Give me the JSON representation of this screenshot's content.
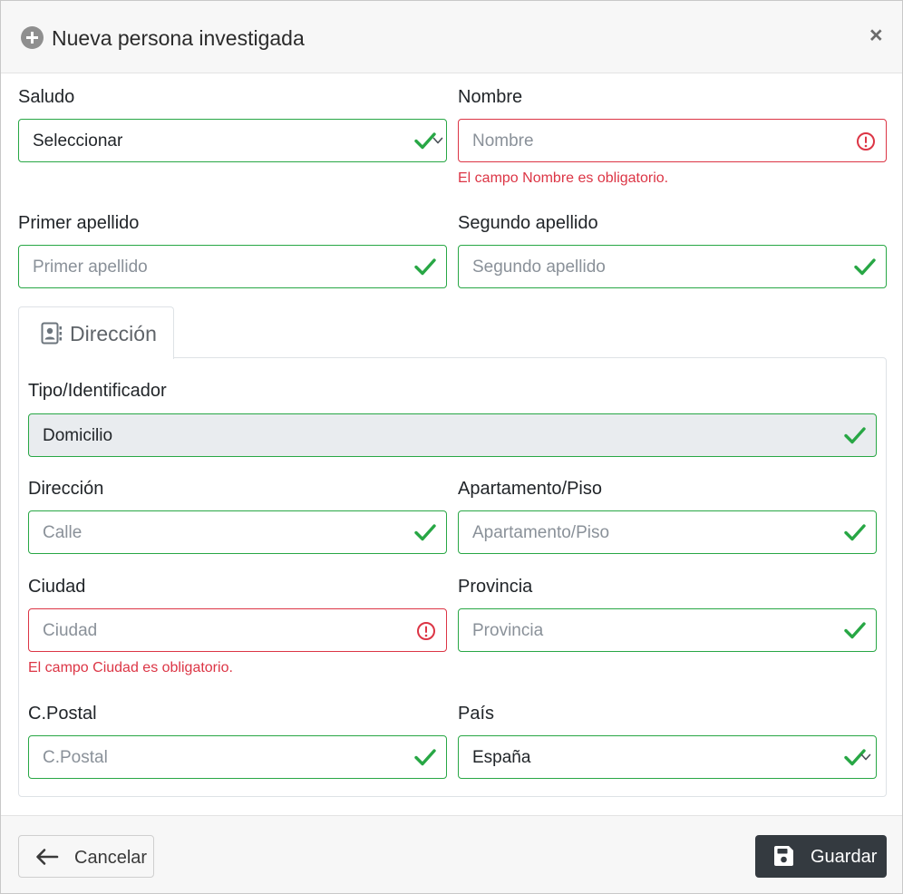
{
  "header": {
    "title": "Nueva persona investigada",
    "close": "×"
  },
  "form": {
    "saludo": {
      "label": "Saludo",
      "value": "Seleccionar"
    },
    "nombre": {
      "label": "Nombre",
      "placeholder": "Nombre",
      "error": "El campo Nombre es obligatorio."
    },
    "primer_apellido": {
      "label": "Primer apellido",
      "placeholder": "Primer apellido"
    },
    "segundo_apellido": {
      "label": "Segundo apellido",
      "placeholder": "Segundo apellido"
    }
  },
  "tab": {
    "label": "Dirección",
    "icon": "address-card-icon"
  },
  "address": {
    "tipo": {
      "label": "Tipo/Identificador",
      "value": "Domicilio"
    },
    "direccion": {
      "label": "Dirección",
      "placeholder": "Calle"
    },
    "apartamento": {
      "label": "Apartamento/Piso",
      "placeholder": "Apartamento/Piso"
    },
    "ciudad": {
      "label": "Ciudad",
      "placeholder": "Ciudad",
      "error": "El campo Ciudad es obligatorio."
    },
    "provincia": {
      "label": "Provincia",
      "placeholder": "Provincia"
    },
    "cpostal": {
      "label": "C.Postal",
      "placeholder": "C.Postal"
    },
    "pais": {
      "label": "País",
      "value": "España"
    }
  },
  "footer": {
    "cancel_label": "Cancelar",
    "save_label": "Guardar"
  },
  "colors": {
    "valid": "#28a745",
    "invalid": "#dc3545",
    "dark_button": "#343a40"
  }
}
